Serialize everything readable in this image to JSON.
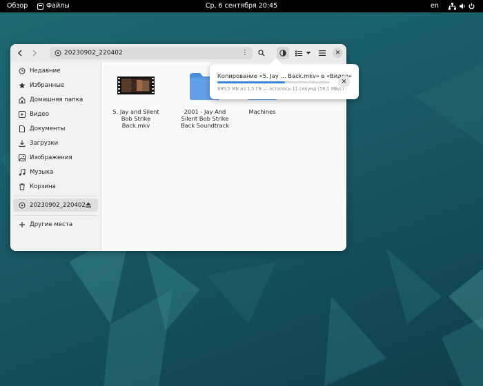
{
  "topbar": {
    "activities": "Обзор",
    "app_name": "Файлы",
    "datetime": "Ср, 6 сентября  20:45",
    "keyboard_layout": "en"
  },
  "window": {
    "location": "20230902_220402"
  },
  "sidebar": {
    "items": [
      {
        "label": "Недавние",
        "icon": "clock-icon"
      },
      {
        "label": "Избранные",
        "icon": "star-icon"
      },
      {
        "label": "Домашняя папка",
        "icon": "home-icon"
      },
      {
        "label": "Видео",
        "icon": "video-icon"
      },
      {
        "label": "Документы",
        "icon": "document-icon"
      },
      {
        "label": "Загрузки",
        "icon": "download-icon"
      },
      {
        "label": "Изображения",
        "icon": "image-icon"
      },
      {
        "label": "Музыка",
        "icon": "music-icon"
      },
      {
        "label": "Корзина",
        "icon": "trash-icon"
      }
    ],
    "device": {
      "label": "20230902_220402",
      "icon": "disc-icon"
    },
    "other": {
      "label": "Другие места",
      "icon": "plus-icon"
    }
  },
  "files": [
    {
      "name": "5. Jay and Silent Bob Strike Back.mkv",
      "type": "video"
    },
    {
      "name": "2001 - Jay And Silent Bob Strike Back Soundtrack",
      "type": "folder"
    },
    {
      "name": "Machines",
      "type": "folder"
    }
  ],
  "operation": {
    "title": "Копирование «5. Jay … Back.mkv» в «Видео»",
    "status": "895,5 МБ из 1,5 ГБ — осталось 11 секунд (56,1 МБ/с)",
    "progress": 0.6
  },
  "colors": {
    "accent": "#3584e4",
    "folder": "#4a90d9",
    "headerbar": "#ebebeb",
    "sidebar": "#f2f2f2"
  }
}
